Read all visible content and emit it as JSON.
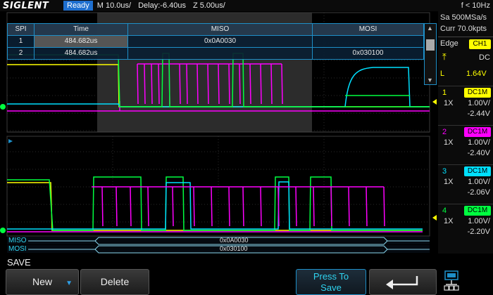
{
  "topbar": {
    "brand": "SIGLENT",
    "status": "Ready",
    "timebase": "M 10.0us/",
    "delay": "Delay:-6.40us",
    "zoom": "Z 5.00us/",
    "trigger_freq": "f < 10Hz"
  },
  "spi_table": {
    "headers": [
      "SPI",
      "Time",
      "MISO",
      "MOSI"
    ],
    "rows": [
      {
        "index": "1",
        "time": "484.682us",
        "miso": "0x0A0030",
        "mosi": ""
      },
      {
        "index": "2",
        "time": "484.682us",
        "miso": "",
        "mosi": "0x030100"
      }
    ]
  },
  "bus": {
    "miso_label": "MISO",
    "miso_value": "0x0A0030",
    "mosi_label": "MOSI",
    "mosi_value": "0x030100"
  },
  "acquisition": {
    "sample_rate": "Sa 500MSa/s",
    "curr_pts": "Curr 70.0kpts"
  },
  "trigger": {
    "type": "Edge",
    "source": "CH1",
    "coupling": "DC",
    "level_label": "L",
    "level": "1.64V"
  },
  "channels": [
    {
      "num": "1",
      "coupling": "DC1M",
      "probe": "1X",
      "scale": "1.00V/",
      "offset": "-2.44V",
      "color": "#ffff00"
    },
    {
      "num": "2",
      "coupling": "DC1M",
      "probe": "1X",
      "scale": "1.00V/",
      "offset": "-2.40V",
      "color": "#ff00ff"
    },
    {
      "num": "3",
      "coupling": "DC1M",
      "probe": "1X",
      "scale": "1.00V/",
      "offset": "-2.06V",
      "color": "#00e0ff"
    },
    {
      "num": "4",
      "coupling": "DC1M",
      "probe": "1X",
      "scale": "1.00V/",
      "offset": "-2.20V",
      "color": "#00ff40"
    }
  ],
  "menu": {
    "title": "SAVE",
    "new_label": "New",
    "delete_label": "Delete",
    "save_line1": "Press To",
    "save_line2": "Save",
    "back_icon": "return-arrow-icon"
  }
}
